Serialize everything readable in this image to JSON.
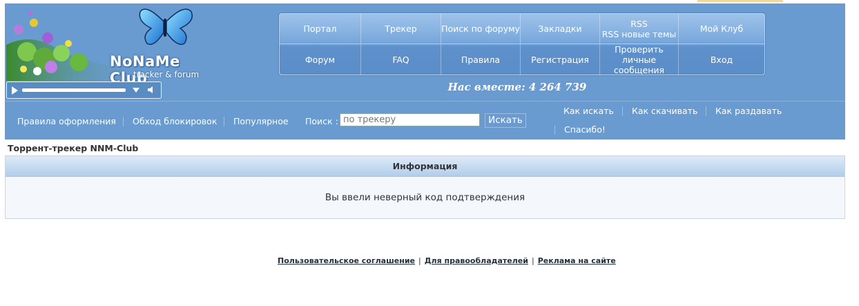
{
  "header": {
    "logo_title": "NoNaMe Club",
    "logo_subtitle": "tracker & forum",
    "together_text": "Нас вместе: 4 264 739"
  },
  "player": {
    "play_icon": "play-icon",
    "volume_icon": "volume-icon"
  },
  "nav": {
    "row1": [
      "Портал",
      "Трекер",
      "Поиск по форуму",
      "Закладки",
      "RSS\nRSS новые темы",
      "Мой Клуб"
    ],
    "row2": [
      "Форум",
      "FAQ",
      "Правила",
      "Регистрация",
      "Проверить\nличные\nсообщения",
      "Вход"
    ]
  },
  "subnav": {
    "rules_label": "Правила оформления",
    "bypass_label": "Обход блокировок",
    "popular_label": "Популярное",
    "search_label": "Поиск :",
    "search_placeholder": "по трекеру",
    "search_button": "Искать",
    "how_search": "Как искать",
    "how_download": "Как скачивать",
    "how_seed": "Как раздавать",
    "thanks": "Спасибо!"
  },
  "page": {
    "site_title": "Торрент-трекер NNM-Club",
    "panel_title": "Информация",
    "message": "Вы ввели неверный код подтверждения"
  },
  "footer": {
    "agreement": "Пользовательское соглашение",
    "rightholders": "Для правообладателей",
    "ads": "Реклама на сайте",
    "separator": "|"
  },
  "colors": {
    "header_bg": "#6a9bd0",
    "panel_bg": "#f4f7fb"
  }
}
